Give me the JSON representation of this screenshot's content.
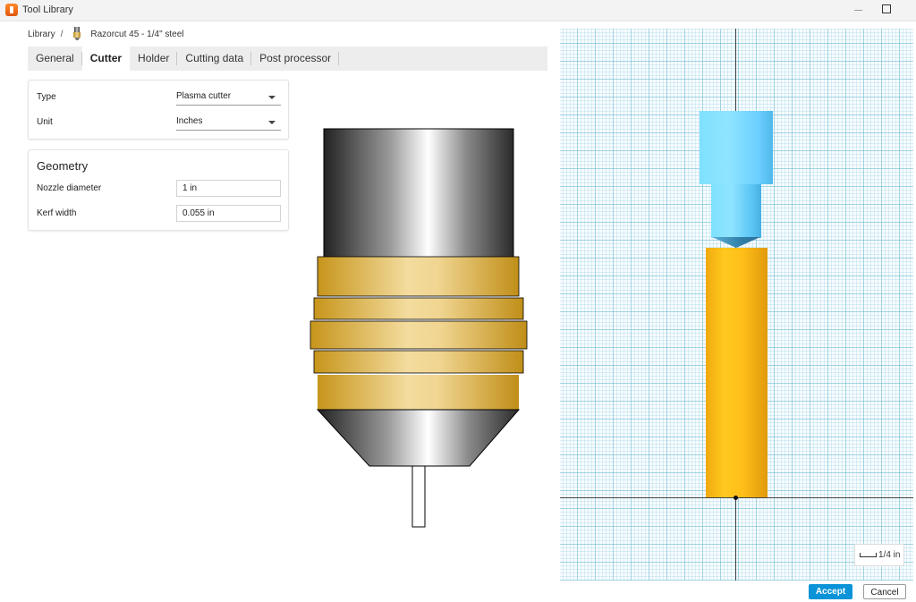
{
  "window": {
    "title": "Tool Library"
  },
  "breadcrumb": {
    "root": "Library",
    "separator": "/",
    "tool_name": "Razorcut 45 - 1/4\" steel"
  },
  "tabs": [
    {
      "label": "General"
    },
    {
      "label": "Cutter",
      "active": true
    },
    {
      "label": "Holder"
    },
    {
      "label": "Cutting data"
    },
    {
      "label": "Post processor"
    }
  ],
  "type_card": {
    "type_label": "Type",
    "type_value": "Plasma cutter",
    "unit_label": "Unit",
    "unit_value": "Inches"
  },
  "geometry": {
    "title": "Geometry",
    "nozzle_label": "Nozzle diameter",
    "nozzle_value": "1 in",
    "kerf_label": "Kerf width",
    "kerf_value": "0.055 in"
  },
  "viewport": {
    "scale_label": "1/4 in"
  },
  "footer": {
    "accept_label": "Accept",
    "cancel_label": "Cancel"
  },
  "colors": {
    "accent": "#0a93d8",
    "holder": "#8fe4ff",
    "cutter": "#ffc91f",
    "nozzle_brass": "#e8c878"
  },
  "icons": [
    "app-icon",
    "plasma-tool-icon",
    "chevron-down-icon",
    "minimize-icon",
    "maximize-icon",
    "scale-ruler-icon"
  ]
}
